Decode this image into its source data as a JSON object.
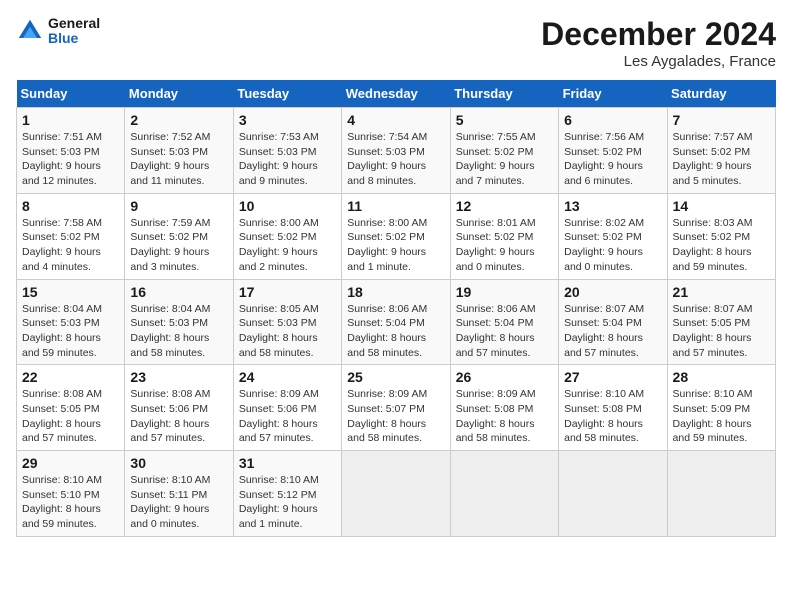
{
  "header": {
    "logo_general": "General",
    "logo_blue": "Blue",
    "month_title": "December 2024",
    "location": "Les Aygalades, France"
  },
  "weekdays": [
    "Sunday",
    "Monday",
    "Tuesday",
    "Wednesday",
    "Thursday",
    "Friday",
    "Saturday"
  ],
  "weeks": [
    [
      {
        "day": "1",
        "info": "Sunrise: 7:51 AM\nSunset: 5:03 PM\nDaylight: 9 hours\nand 12 minutes."
      },
      {
        "day": "2",
        "info": "Sunrise: 7:52 AM\nSunset: 5:03 PM\nDaylight: 9 hours\nand 11 minutes."
      },
      {
        "day": "3",
        "info": "Sunrise: 7:53 AM\nSunset: 5:03 PM\nDaylight: 9 hours\nand 9 minutes."
      },
      {
        "day": "4",
        "info": "Sunrise: 7:54 AM\nSunset: 5:03 PM\nDaylight: 9 hours\nand 8 minutes."
      },
      {
        "day": "5",
        "info": "Sunrise: 7:55 AM\nSunset: 5:02 PM\nDaylight: 9 hours\nand 7 minutes."
      },
      {
        "day": "6",
        "info": "Sunrise: 7:56 AM\nSunset: 5:02 PM\nDaylight: 9 hours\nand 6 minutes."
      },
      {
        "day": "7",
        "info": "Sunrise: 7:57 AM\nSunset: 5:02 PM\nDaylight: 9 hours\nand 5 minutes."
      }
    ],
    [
      {
        "day": "8",
        "info": "Sunrise: 7:58 AM\nSunset: 5:02 PM\nDaylight: 9 hours\nand 4 minutes."
      },
      {
        "day": "9",
        "info": "Sunrise: 7:59 AM\nSunset: 5:02 PM\nDaylight: 9 hours\nand 3 minutes."
      },
      {
        "day": "10",
        "info": "Sunrise: 8:00 AM\nSunset: 5:02 PM\nDaylight: 9 hours\nand 2 minutes."
      },
      {
        "day": "11",
        "info": "Sunrise: 8:00 AM\nSunset: 5:02 PM\nDaylight: 9 hours\nand 1 minute."
      },
      {
        "day": "12",
        "info": "Sunrise: 8:01 AM\nSunset: 5:02 PM\nDaylight: 9 hours\nand 0 minutes."
      },
      {
        "day": "13",
        "info": "Sunrise: 8:02 AM\nSunset: 5:02 PM\nDaylight: 9 hours\nand 0 minutes."
      },
      {
        "day": "14",
        "info": "Sunrise: 8:03 AM\nSunset: 5:02 PM\nDaylight: 8 hours\nand 59 minutes."
      }
    ],
    [
      {
        "day": "15",
        "info": "Sunrise: 8:04 AM\nSunset: 5:03 PM\nDaylight: 8 hours\nand 59 minutes."
      },
      {
        "day": "16",
        "info": "Sunrise: 8:04 AM\nSunset: 5:03 PM\nDaylight: 8 hours\nand 58 minutes."
      },
      {
        "day": "17",
        "info": "Sunrise: 8:05 AM\nSunset: 5:03 PM\nDaylight: 8 hours\nand 58 minutes."
      },
      {
        "day": "18",
        "info": "Sunrise: 8:06 AM\nSunset: 5:04 PM\nDaylight: 8 hours\nand 58 minutes."
      },
      {
        "day": "19",
        "info": "Sunrise: 8:06 AM\nSunset: 5:04 PM\nDaylight: 8 hours\nand 57 minutes."
      },
      {
        "day": "20",
        "info": "Sunrise: 8:07 AM\nSunset: 5:04 PM\nDaylight: 8 hours\nand 57 minutes."
      },
      {
        "day": "21",
        "info": "Sunrise: 8:07 AM\nSunset: 5:05 PM\nDaylight: 8 hours\nand 57 minutes."
      }
    ],
    [
      {
        "day": "22",
        "info": "Sunrise: 8:08 AM\nSunset: 5:05 PM\nDaylight: 8 hours\nand 57 minutes."
      },
      {
        "day": "23",
        "info": "Sunrise: 8:08 AM\nSunset: 5:06 PM\nDaylight: 8 hours\nand 57 minutes."
      },
      {
        "day": "24",
        "info": "Sunrise: 8:09 AM\nSunset: 5:06 PM\nDaylight: 8 hours\nand 57 minutes."
      },
      {
        "day": "25",
        "info": "Sunrise: 8:09 AM\nSunset: 5:07 PM\nDaylight: 8 hours\nand 58 minutes."
      },
      {
        "day": "26",
        "info": "Sunrise: 8:09 AM\nSunset: 5:08 PM\nDaylight: 8 hours\nand 58 minutes."
      },
      {
        "day": "27",
        "info": "Sunrise: 8:10 AM\nSunset: 5:08 PM\nDaylight: 8 hours\nand 58 minutes."
      },
      {
        "day": "28",
        "info": "Sunrise: 8:10 AM\nSunset: 5:09 PM\nDaylight: 8 hours\nand 59 minutes."
      }
    ],
    [
      {
        "day": "29",
        "info": "Sunrise: 8:10 AM\nSunset: 5:10 PM\nDaylight: 8 hours\nand 59 minutes."
      },
      {
        "day": "30",
        "info": "Sunrise: 8:10 AM\nSunset: 5:11 PM\nDaylight: 9 hours\nand 0 minutes."
      },
      {
        "day": "31",
        "info": "Sunrise: 8:10 AM\nSunset: 5:12 PM\nDaylight: 9 hours\nand 1 minute."
      },
      {
        "day": "",
        "info": ""
      },
      {
        "day": "",
        "info": ""
      },
      {
        "day": "",
        "info": ""
      },
      {
        "day": "",
        "info": ""
      }
    ]
  ]
}
